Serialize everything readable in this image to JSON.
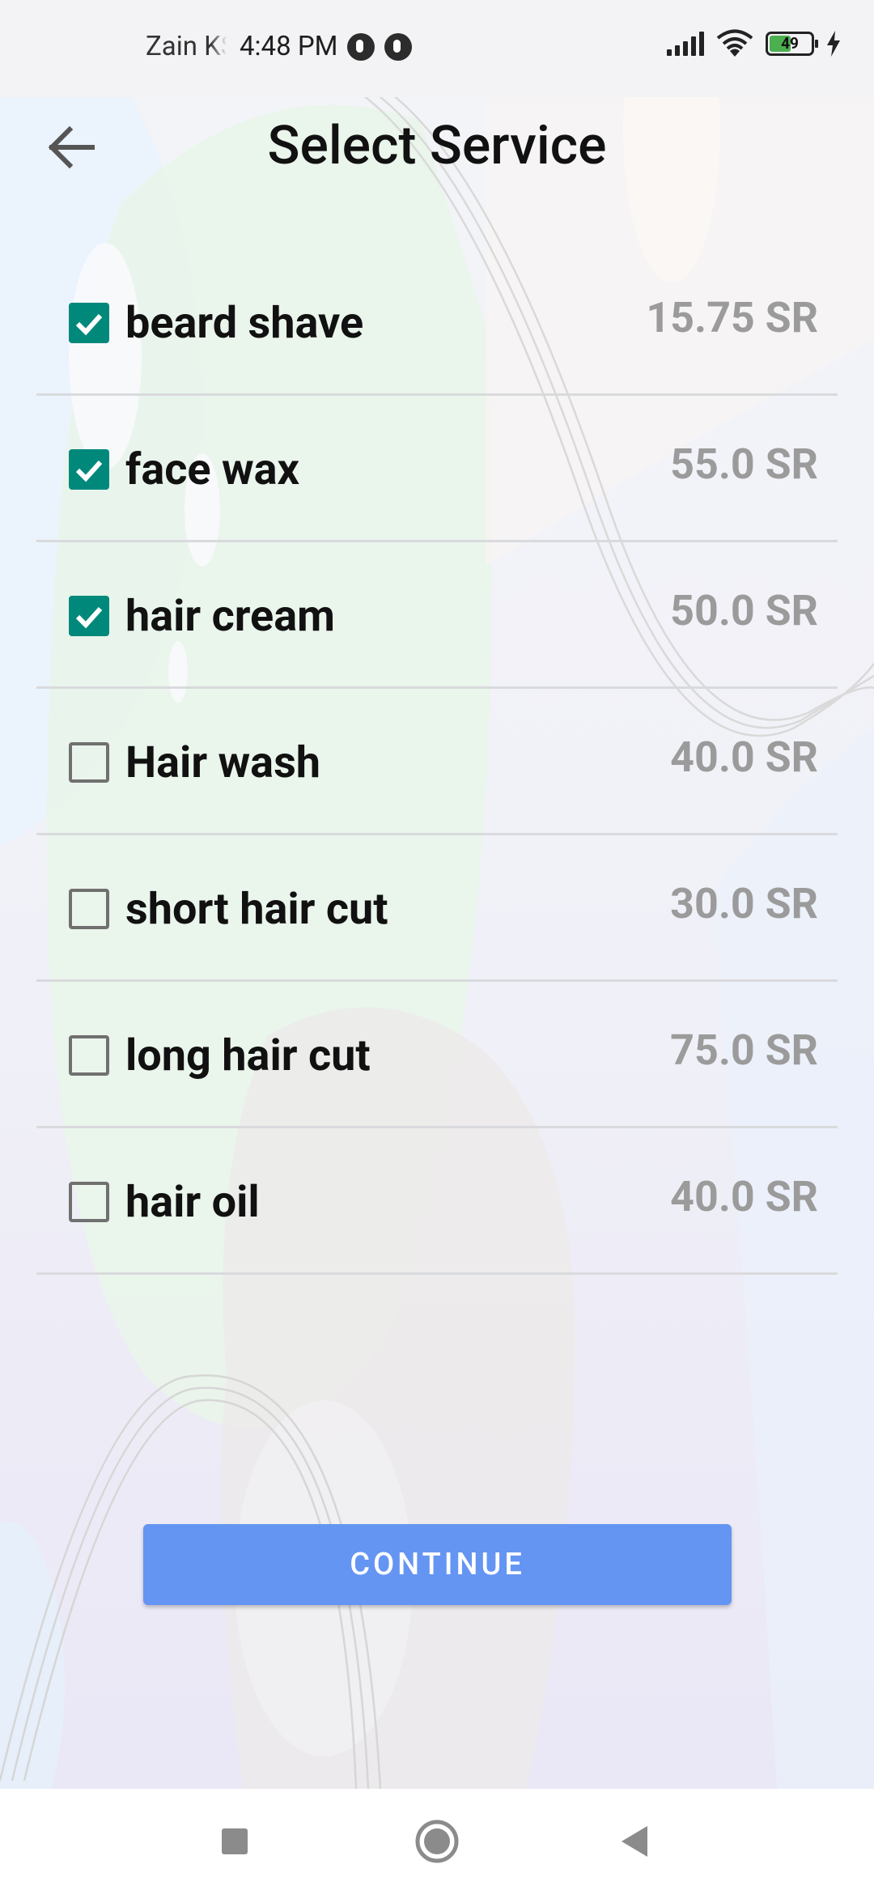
{
  "status_bar": {
    "carrier": "Zain KSA",
    "time": "4:48 PM",
    "battery_level": "49",
    "battery_fraction": 0.49
  },
  "header": {
    "title": "Select Service",
    "back_icon": "arrow-left-icon"
  },
  "services": [
    {
      "name": "beard shave",
      "price": "15.75 SR",
      "checked": true
    },
    {
      "name": "face wax",
      "price": "55.0 SR",
      "checked": true
    },
    {
      "name": "hair cream",
      "price": "50.0 SR",
      "checked": true
    },
    {
      "name": "Hair wash",
      "price": "40.0 SR",
      "checked": false
    },
    {
      "name": "short hair cut",
      "price": "30.0 SR",
      "checked": false
    },
    {
      "name": "long hair cut",
      "price": "75.0 SR",
      "checked": false
    },
    {
      "name": "hair oil",
      "price": "40.0 SR",
      "checked": false
    }
  ],
  "continue_label": "CONTINUE",
  "colors": {
    "checkbox_checked": "#00897b",
    "button": "#6495f2",
    "price_text": "#9b9b9b"
  },
  "nav_bar": {
    "icons": [
      "square-recents-icon",
      "circle-home-icon",
      "triangle-back-icon"
    ]
  }
}
